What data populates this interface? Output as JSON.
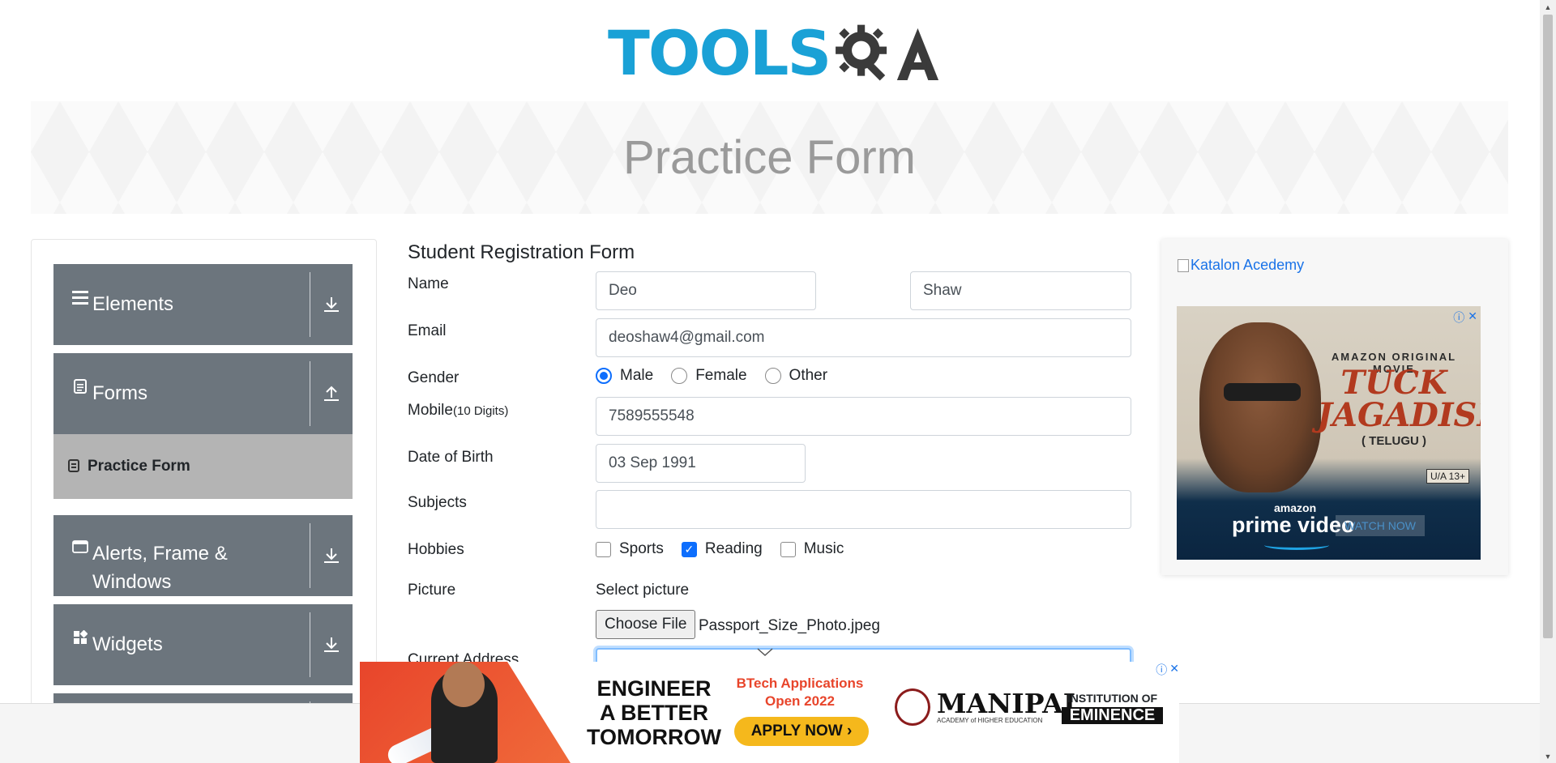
{
  "logo": {
    "tools": "TOOLS",
    "qa": "QA"
  },
  "banner": {
    "title": "Practice Form"
  },
  "sidebar": {
    "groups": [
      {
        "label": "Elements",
        "icon": "hamburger-icon",
        "arrow": "download-icon"
      },
      {
        "label": "Forms",
        "icon": "document-icon",
        "arrow": "upload-icon"
      },
      {
        "label": "Alerts, Frame &",
        "label2": "Windows",
        "icon": "window-icon",
        "arrow": "download-icon"
      },
      {
        "label": "Widgets",
        "icon": "widgets-icon",
        "arrow": "download-icon"
      }
    ],
    "sub_items": [
      {
        "label": "Practice Form",
        "icon": "form-icon"
      }
    ]
  },
  "form": {
    "title": "Student Registration Form",
    "labels": {
      "name": "Name",
      "email": "Email",
      "gender": "Gender",
      "mobile": "Mobile",
      "mobile_hint": "(10 Digits)",
      "dob": "Date of Birth",
      "subjects": "Subjects",
      "hobbies": "Hobbies",
      "picture": "Picture",
      "address": "Current Address"
    },
    "first_name": "Deo",
    "last_name": "Shaw",
    "email": "deoshaw4@gmail.com",
    "gender_options": [
      "Male",
      "Female",
      "Other"
    ],
    "gender_selected": "Male",
    "mobile": "7589555548",
    "dob": "03 Sep 1991",
    "subjects": "",
    "hobby_options": [
      "Sports",
      "Reading",
      "Music"
    ],
    "hobbies_checked": [
      "Reading"
    ],
    "picture_label": "Select picture",
    "file_button": "Choose File",
    "file_name": "Passport_Size_Photo.jpeg"
  },
  "ad_right": {
    "broken_image_alt": "Katalon Acedemy",
    "kicker": "AMAZON ORIGINAL MOVIE",
    "title_line1": "TUCK",
    "title_line2": "JAGADISH",
    "language": "( TELUGU )",
    "rating": "U/A 13+",
    "amazon": "amazon",
    "prime": "prime video",
    "cta": "WATCH NOW",
    "close": "✕",
    "info": "ⓘ"
  },
  "ad_bottom": {
    "headline1": "ENGINEER",
    "headline2": "A BETTER",
    "headline3": "TOMORROW",
    "btech1": "BTech Applications",
    "btech2": "Open 2022",
    "apply": "APPLY NOW ›",
    "manipal": "MANIPAL",
    "manipal_sub": "ACADEMY of HIGHER EDUCATION",
    "inst1": "INSTITUTION OF",
    "inst2": "EMINENCE",
    "close": "✕",
    "info": "ⓘ"
  },
  "colors": {
    "sidebar": "#6c757d",
    "active_sub": "#b4b4b4",
    "accent": "#0d6efd",
    "logo_blue": "#1aa1d6"
  }
}
